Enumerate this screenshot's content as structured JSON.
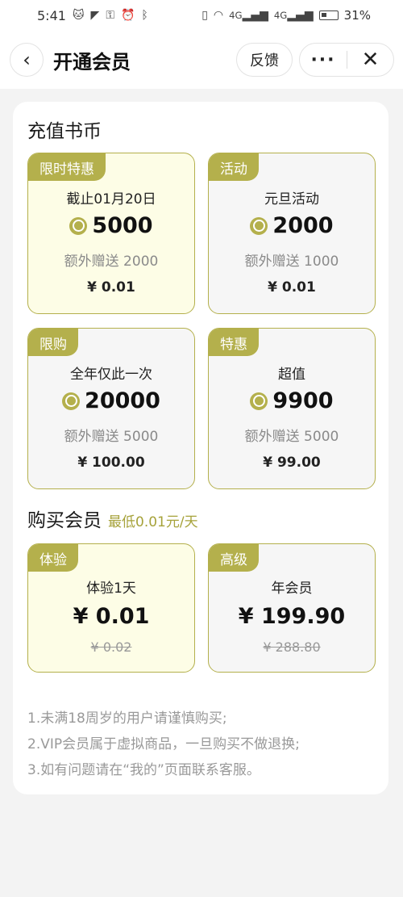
{
  "status_bar": {
    "time": "5:41",
    "net_1": "4G",
    "net_2": "4G",
    "battery": "31%"
  },
  "nav": {
    "title": "开通会员",
    "feedback": "反馈",
    "more": "···",
    "close": "✕",
    "back": "‹"
  },
  "recharge": {
    "title": "充值书币",
    "tiles": [
      {
        "badge": "限时特惠",
        "line1": "截止01月20日",
        "amount": "5000",
        "bonus": "额外赠送 2000",
        "price": "¥ 0.01",
        "highlight": true
      },
      {
        "badge": "活动",
        "line1": "元旦活动",
        "amount": "2000",
        "bonus": "额外赠送 1000",
        "price": "¥ 0.01",
        "highlight": false
      },
      {
        "badge": "限购",
        "line1": "全年仅此一次",
        "amount": "20000",
        "bonus": "额外赠送 5000",
        "price": "¥ 100.00",
        "highlight": false
      },
      {
        "badge": "特惠",
        "line1": "超值",
        "amount": "9900",
        "bonus": "额外赠送 5000",
        "price": "¥ 99.00",
        "highlight": false
      }
    ]
  },
  "membership": {
    "title": "购买会员",
    "subtitle": "最低0.01元/天",
    "plans": [
      {
        "badge": "体验",
        "name": "体验1天",
        "price": "¥ 0.01",
        "original": "¥ 0.02",
        "highlight": true
      },
      {
        "badge": "高级",
        "name": "年会员",
        "price": "¥ 199.90",
        "original": "¥ 288.80",
        "highlight": false
      }
    ]
  },
  "notes": [
    "1.未满18周岁的用户请谨慎购买;",
    "2.VIP会员属于虚拟商品，一旦购买不做退换;",
    "3.如有问题请在“我的”页面联系客服。"
  ],
  "colors": {
    "accent": "#b4b04c",
    "highlight_bg": "#fdfde6",
    "normal_bg": "#f6f6f6",
    "page_bg": "#f3f3f3"
  }
}
